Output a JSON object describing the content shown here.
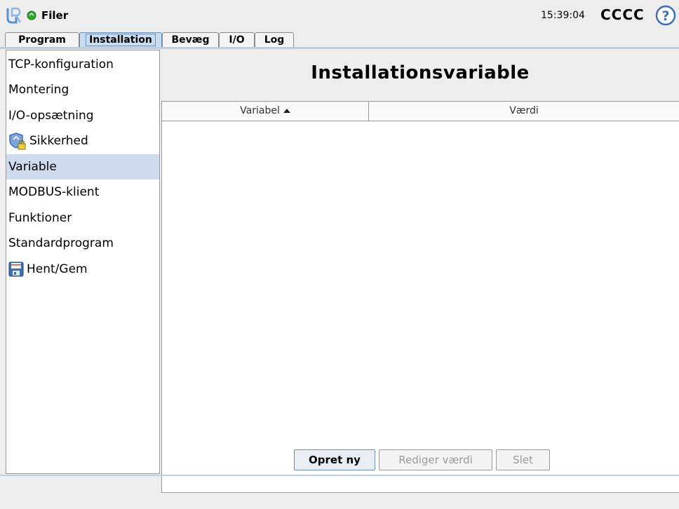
{
  "header": {
    "menu_label": "Filer",
    "clock": "15:39:04",
    "robot_name": "CCCC",
    "status_color": "#2ea62e",
    "logo_color": "#5a8fd8"
  },
  "tabs": [
    {
      "label": "Program",
      "active": false
    },
    {
      "label": "Installation",
      "active": true
    },
    {
      "label": "Bevæg",
      "active": false
    },
    {
      "label": "I/O",
      "active": false
    },
    {
      "label": "Log",
      "active": false
    }
  ],
  "sidebar": {
    "items": [
      {
        "label": "TCP-konfiguration",
        "icon": null,
        "selected": false
      },
      {
        "label": "Montering",
        "icon": null,
        "selected": false
      },
      {
        "label": "I/O-opsætning",
        "icon": null,
        "selected": false
      },
      {
        "label": "Sikkerhed",
        "icon": "shield-lock-icon",
        "selected": false
      },
      {
        "label": "Variable",
        "icon": null,
        "selected": true
      },
      {
        "label": "MODBUS-klient",
        "icon": null,
        "selected": false
      },
      {
        "label": "Funktioner",
        "icon": null,
        "selected": false
      },
      {
        "label": "Standardprogram",
        "icon": null,
        "selected": false
      },
      {
        "label": "Hent/Gem",
        "icon": "floppy-disk-icon",
        "selected": false
      }
    ]
  },
  "main": {
    "title": "Installationsvariable",
    "table": {
      "columns": [
        "Variabel",
        "Værdi"
      ],
      "sort_column": "Variabel",
      "sort_direction": "ascending",
      "rows": []
    },
    "buttons": {
      "create": "Opret ny",
      "edit": "Rediger værdi",
      "delete": "Slet"
    }
  }
}
